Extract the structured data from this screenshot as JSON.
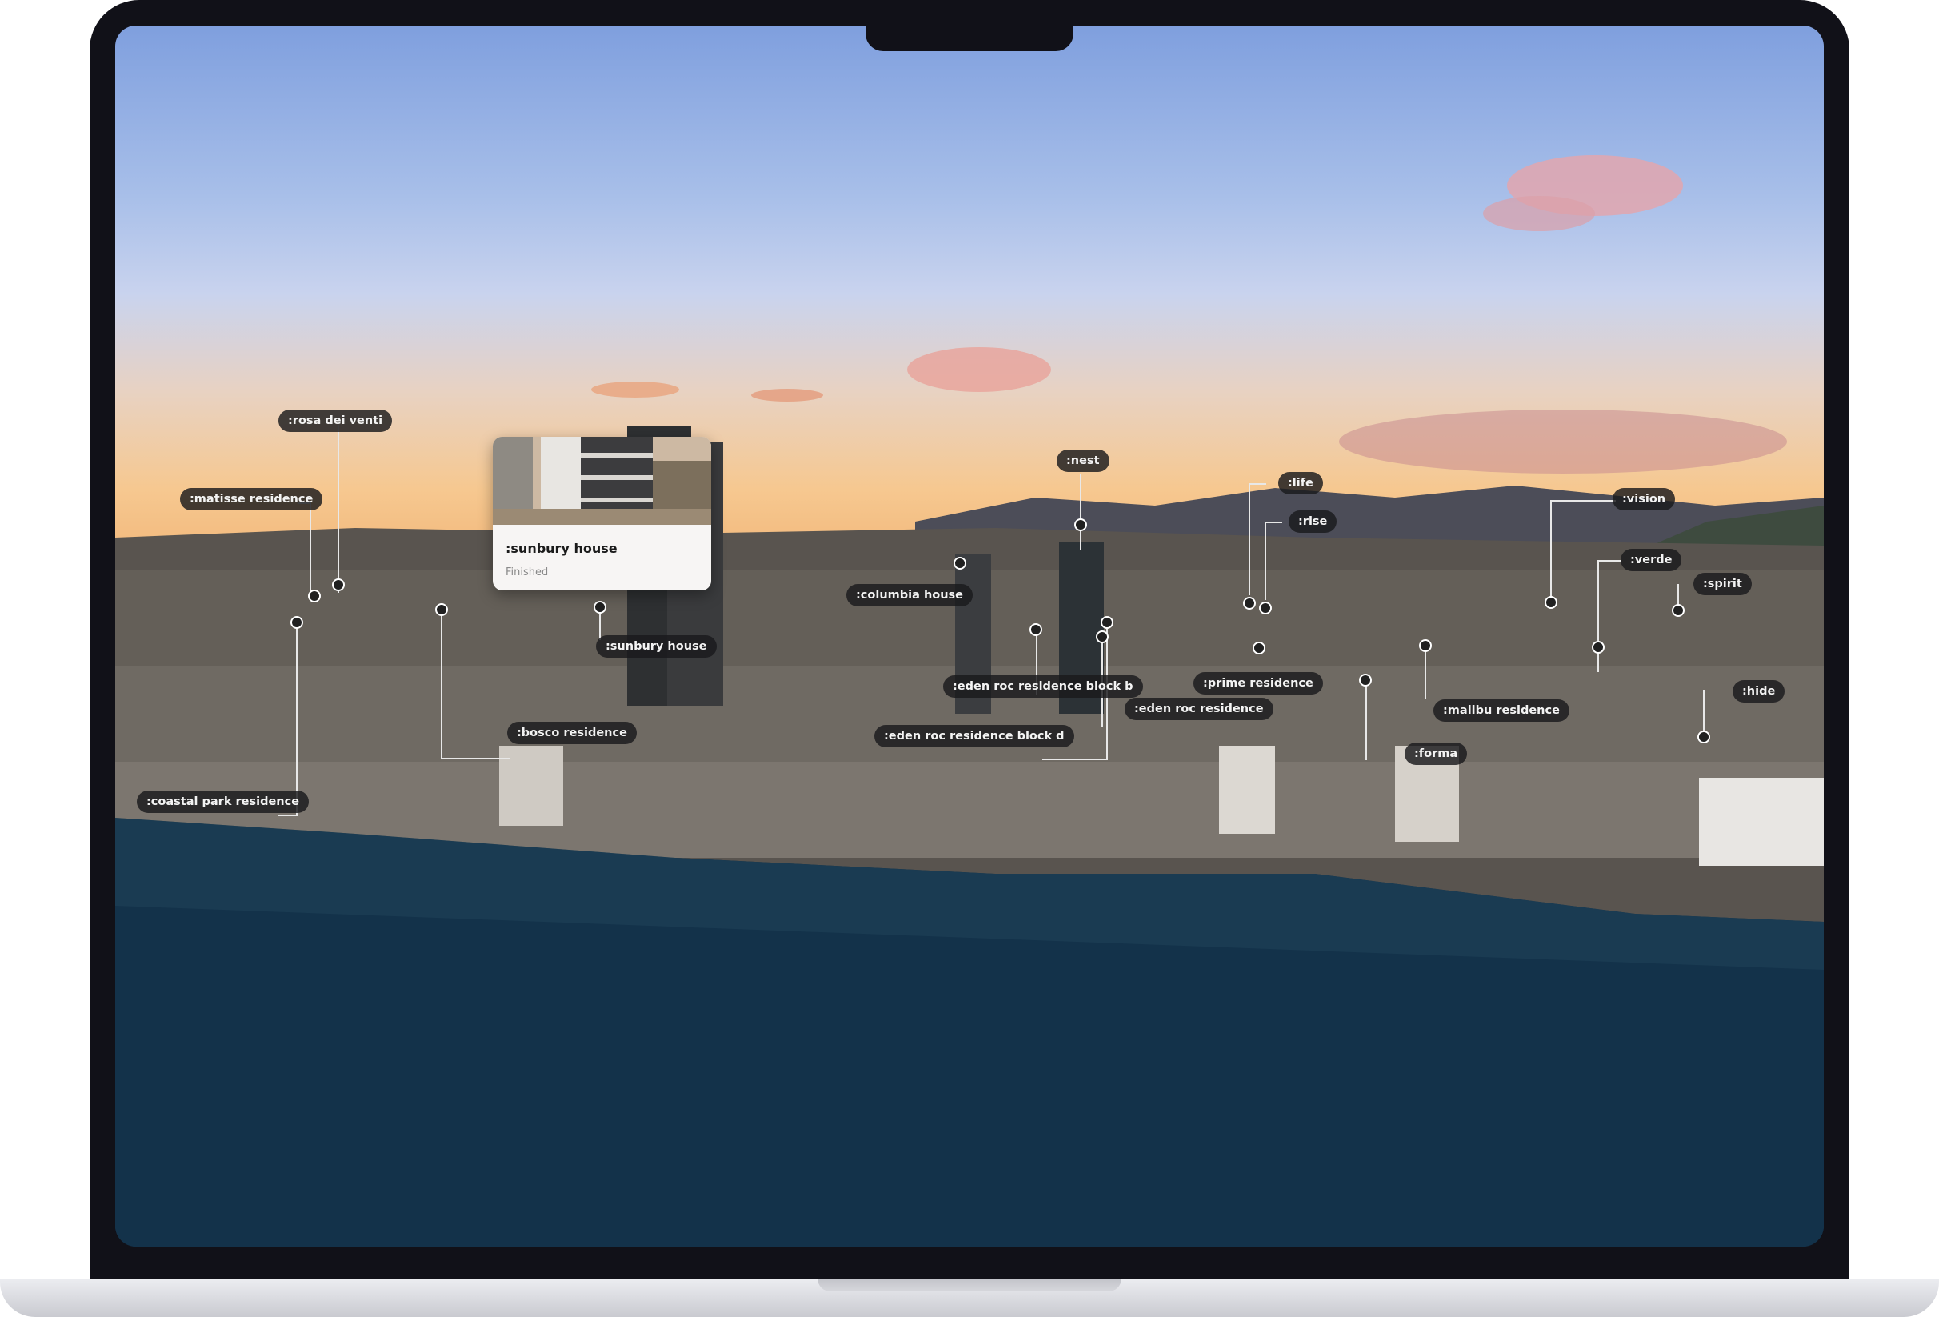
{
  "project_card": {
    "title": ":sunbury house",
    "status": "Finished"
  },
  "markers": [
    {
      "label": ":rosa dei venti"
    },
    {
      "label": ":matisse residence"
    },
    {
      "label": ":coastal park residence"
    },
    {
      "label": ":bosco residence"
    },
    {
      "label": ":sunbury house"
    },
    {
      "label": ":columbia house"
    },
    {
      "label": ":eden roc residence block b"
    },
    {
      "label": ":eden roc residence block d"
    },
    {
      "label": ":nest"
    },
    {
      "label": ":eden roc residence"
    },
    {
      "label": ":life"
    },
    {
      "label": ":rise"
    },
    {
      "label": ":prime residence"
    },
    {
      "label": ":forma"
    },
    {
      "label": ":malibu residence"
    },
    {
      "label": ":vision"
    },
    {
      "label": ":verde"
    },
    {
      "label": ":spirit"
    },
    {
      "label": ":hide"
    }
  ],
  "colors": {
    "frame": "#111118",
    "tag_background": "#1a1a1c",
    "tag_text": "#f3f3f3",
    "card_background": "#f7f5f4"
  }
}
